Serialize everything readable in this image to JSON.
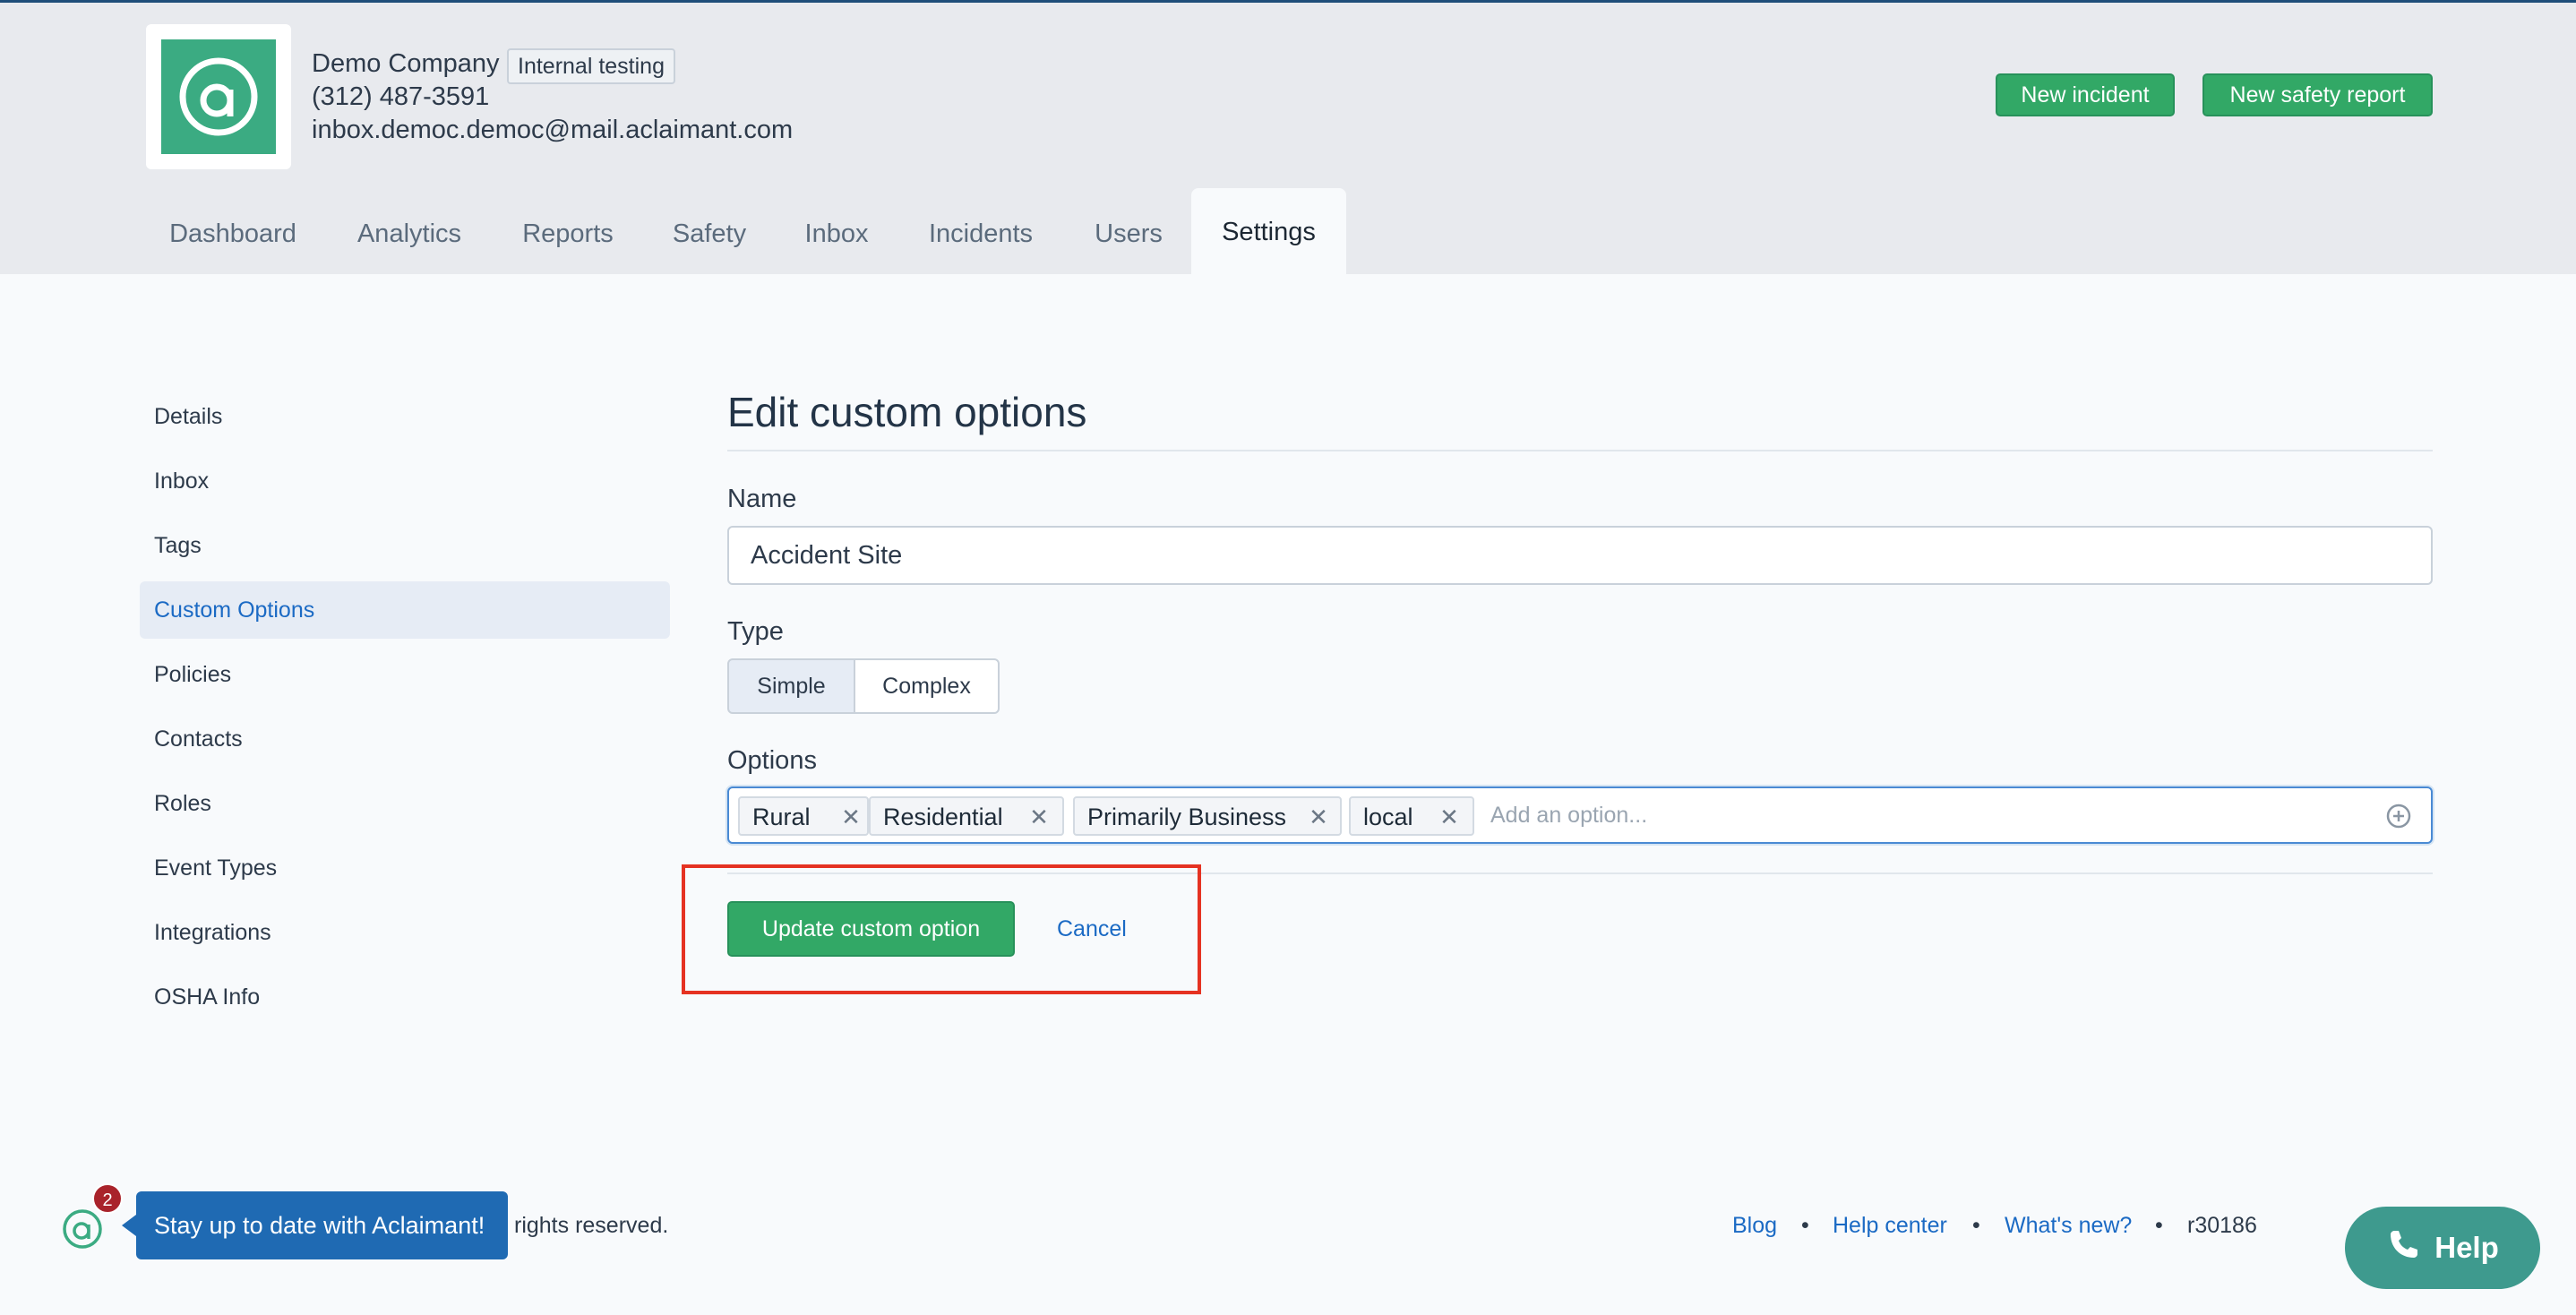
{
  "company": {
    "name": "Demo Company",
    "env_badge": "Internal testing",
    "phone": "(312) 487-3591",
    "email": "inbox.democ.democ@mail.aclaimant.com"
  },
  "header_actions": {
    "new_incident": "New incident",
    "new_safety_report": "New safety report"
  },
  "nav": {
    "tabs": [
      "Dashboard",
      "Analytics",
      "Reports",
      "Safety",
      "Inbox",
      "Incidents",
      "Users",
      "Settings"
    ],
    "active": "Settings"
  },
  "sidebar": {
    "items": [
      "Details",
      "Inbox",
      "Tags",
      "Custom Options",
      "Policies",
      "Contacts",
      "Roles",
      "Event Types",
      "Integrations",
      "OSHA Info"
    ],
    "active": "Custom Options"
  },
  "form": {
    "title": "Edit custom options",
    "name_label": "Name",
    "name_value": "Accident Site",
    "type_label": "Type",
    "type_options": [
      "Simple",
      "Complex"
    ],
    "type_selected": "Simple",
    "options_label": "Options",
    "options": [
      "Rural",
      "Residential",
      "Primarily Business",
      "local"
    ],
    "add_placeholder": "Add an option...",
    "submit_label": "Update custom option",
    "cancel_label": "Cancel"
  },
  "footer": {
    "copyright_tail": "rights reserved.",
    "links": [
      "Blog",
      "Help center",
      "What's new?"
    ],
    "separator": "•",
    "version": "r30186"
  },
  "promo": {
    "badge_count": "2",
    "message": "Stay up to date with Aclaimant!"
  },
  "help": {
    "label": "Help"
  },
  "colors": {
    "brand_green": "#3bab82",
    "button_green": "#32a866",
    "link_blue": "#1b6ac4",
    "highlight_red": "#e53222",
    "help_teal": "#3e9a8e"
  }
}
